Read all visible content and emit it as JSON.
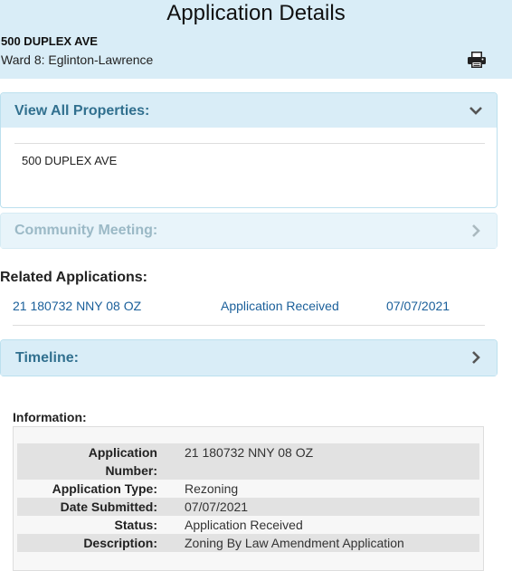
{
  "header": {
    "title": "Application Details",
    "address": "500 DUPLEX AVE",
    "ward": "Ward 8: Eglinton-Lawrence",
    "print_icon": "printer-icon"
  },
  "panels": {
    "properties": {
      "title": "View All Properties:",
      "expanded": true,
      "items": [
        "500 DUPLEX AVE"
      ]
    },
    "community_meeting": {
      "title": "Community Meeting:",
      "expanded": false,
      "disabled": true
    },
    "timeline": {
      "title": "Timeline:",
      "expanded": false
    }
  },
  "related": {
    "title": "Related Applications:",
    "rows": [
      {
        "number": "21 180732 NNY 08 OZ",
        "status": "Application Received",
        "date": "07/07/2021"
      }
    ]
  },
  "information": {
    "label": "Information:",
    "fields": [
      {
        "key_line1": "Application",
        "key_line2": "Number:",
        "value": "21 180732 NNY 08 OZ"
      },
      {
        "key_line1": "Application Type:",
        "key_line2": "",
        "value": "Rezoning"
      },
      {
        "key_line1": "Date Submitted:",
        "key_line2": "",
        "value": "07/07/2021"
      },
      {
        "key_line1": "Status:",
        "key_line2": "",
        "value": "Application Received"
      },
      {
        "key_line1": "Description:",
        "key_line2": "",
        "value": "Zoning By Law Amendment Application"
      }
    ]
  },
  "colors": {
    "header_bg": "#d9edf7",
    "panel_title": "#31708f",
    "link": "#1a5f9a"
  }
}
